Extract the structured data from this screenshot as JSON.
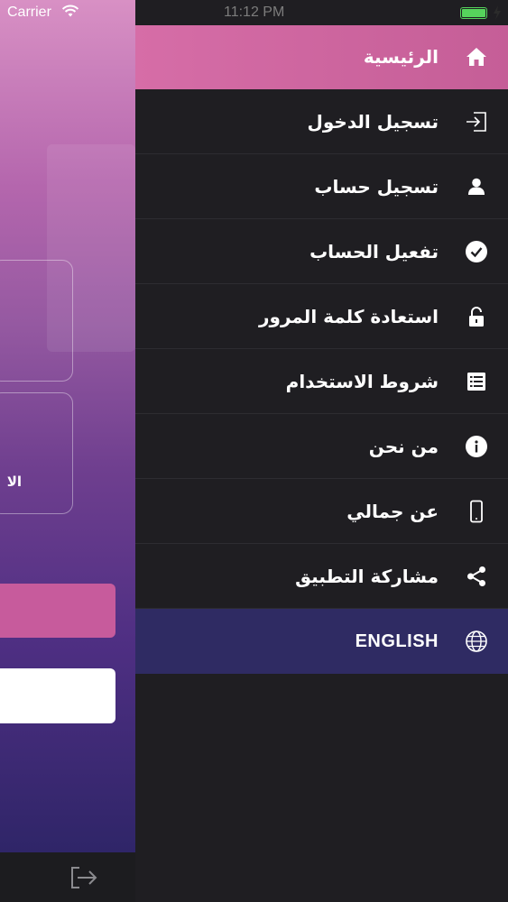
{
  "status_bar": {
    "carrier": "Carrier",
    "time": "11:12 PM",
    "battery_color": "#56d45c"
  },
  "background_screen": {
    "field_label_fragment": "الا",
    "primary_button_color": "#c75b9c",
    "logout_icon": "logout-icon"
  },
  "menu": {
    "items": [
      {
        "label": "الرئيسية",
        "icon": "home-icon"
      },
      {
        "label": "تسجيل الدخول",
        "icon": "sign-in-icon"
      },
      {
        "label": "تسجيل حساب",
        "icon": "user-icon"
      },
      {
        "label": "تفعيل الحساب",
        "icon": "check-circle-icon"
      },
      {
        "label": "استعادة كلمة المرور",
        "icon": "unlock-icon"
      },
      {
        "label": "شروط الاستخدام",
        "icon": "list-icon"
      },
      {
        "label": "من نحن",
        "icon": "info-icon"
      },
      {
        "label": "عن جمالي",
        "icon": "mobile-icon"
      },
      {
        "label": "مشاركة التطبيق",
        "icon": "share-icon"
      },
      {
        "label": "ENGLISH",
        "icon": "globe-icon"
      }
    ],
    "active_color": "#d66da7",
    "language_row_color": "#2f2b63",
    "background_color": "#1f1e22"
  }
}
